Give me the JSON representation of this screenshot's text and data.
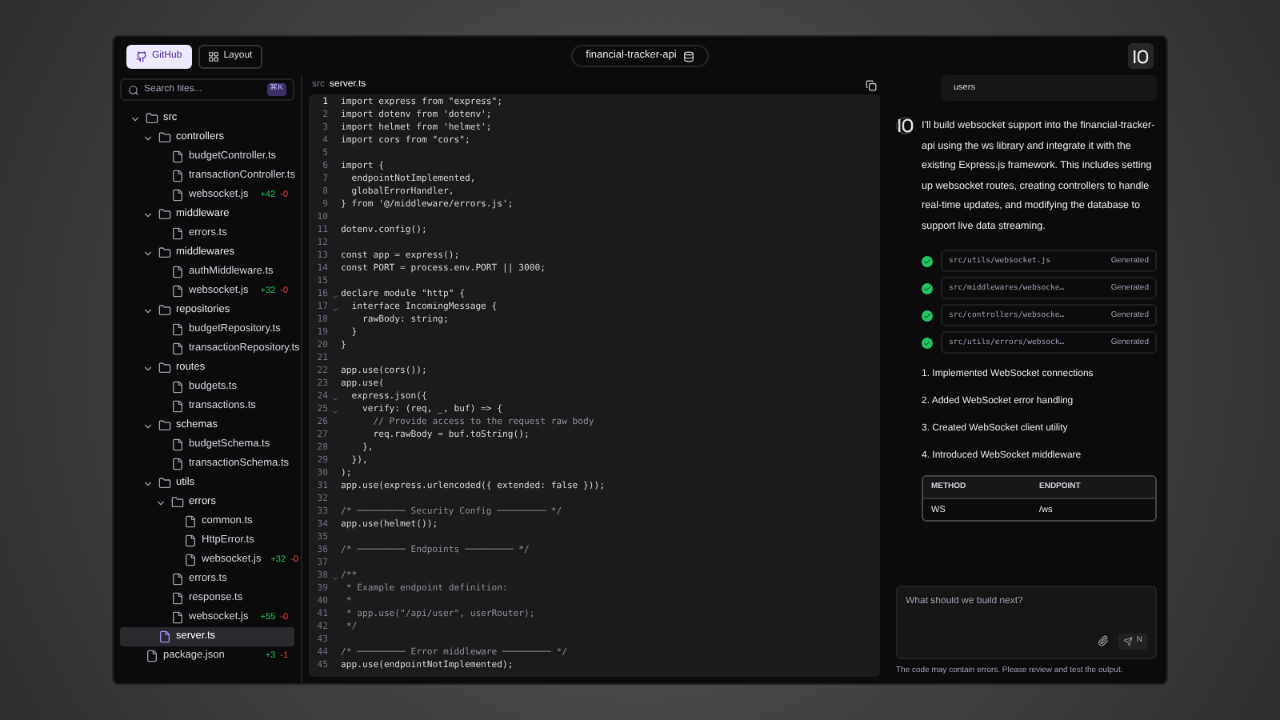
{
  "header": {
    "tabs": [
      {
        "label": "GitHub",
        "selected": true
      },
      {
        "label": "Layout",
        "selected": false
      }
    ],
    "project": "financial-tracker-api"
  },
  "sidebar": {
    "search": {
      "placeholder": "Search files...",
      "shortcut": "⌘K"
    },
    "tree": [
      {
        "name": "src",
        "kind": "folder",
        "expanded": true,
        "children": [
          {
            "name": "controllers",
            "kind": "folder",
            "expanded": true,
            "children": [
              {
                "name": "budgetController.ts",
                "kind": "file",
                "selected": false
              },
              {
                "name": "transactionController.ts",
                "kind": "file",
                "selected": false
              },
              {
                "name": "websocket.js",
                "kind": "file",
                "selected": false,
                "added": "+42",
                "removed": "-0"
              }
            ]
          },
          {
            "name": "middleware",
            "kind": "folder",
            "expanded": true,
            "children": [
              {
                "name": "errors.ts",
                "kind": "file",
                "selected": false
              }
            ]
          },
          {
            "name": "middlewares",
            "kind": "folder",
            "expanded": true,
            "children": [
              {
                "name": "authMiddleware.ts",
                "kind": "file",
                "selected": false
              },
              {
                "name": "websocket.js",
                "kind": "file",
                "selected": false,
                "added": "+32",
                "removed": "-0"
              }
            ]
          },
          {
            "name": "repositories",
            "kind": "folder",
            "expanded": true,
            "children": [
              {
                "name": "budgetRepository.ts",
                "kind": "file",
                "selected": false
              },
              {
                "name": "transactionRepository.ts",
                "kind": "file",
                "selected": false
              }
            ]
          },
          {
            "name": "routes",
            "kind": "folder",
            "expanded": true,
            "children": [
              {
                "name": "budgets.ts",
                "kind": "file",
                "selected": false
              },
              {
                "name": "transactions.ts",
                "kind": "file",
                "selected": false
              }
            ]
          },
          {
            "name": "schemas",
            "kind": "folder",
            "expanded": true,
            "children": [
              {
                "name": "budgetSchema.ts",
                "kind": "file",
                "selected": false
              },
              {
                "name": "transactionSchema.ts",
                "kind": "file",
                "selected": false
              }
            ]
          },
          {
            "name": "utils",
            "kind": "folder",
            "expanded": true,
            "children": [
              {
                "name": "errors",
                "kind": "folder",
                "expanded": true,
                "children": [
                  {
                    "name": "common.ts",
                    "kind": "file",
                    "selected": false
                  },
                  {
                    "name": "HttpError.ts",
                    "kind": "file",
                    "selected": false
                  },
                  {
                    "name": "websocket.js",
                    "kind": "file",
                    "selected": false,
                    "added": "+32",
                    "removed": "-0"
                  }
                ]
              },
              {
                "name": "errors.ts",
                "kind": "file",
                "selected": false
              },
              {
                "name": "response.ts",
                "kind": "file",
                "selected": false
              },
              {
                "name": "websocket.js",
                "kind": "file",
                "selected": false,
                "added": "+55",
                "removed": "-0"
              }
            ]
          },
          {
            "name": "server.ts",
            "kind": "file",
            "selected": true
          }
        ]
      },
      {
        "name": "package.json",
        "kind": "file",
        "selected": false,
        "added": "+3",
        "removed": "-1"
      }
    ]
  },
  "editor": {
    "path": [
      "src",
      "server.ts"
    ],
    "lines": [
      {
        "number": "1",
        "kind": "code",
        "code": "import express from \"express\";"
      },
      {
        "number": "2",
        "kind": "code",
        "code": "import dotenv from 'dotenv';"
      },
      {
        "number": "3",
        "kind": "code",
        "code": "import helmet from 'helmet';"
      },
      {
        "number": "4",
        "kind": "code",
        "code": "import cors from \"cors\";"
      },
      {
        "number": "5"
      },
      {
        "number": "6",
        "kind": "code",
        "code": "import {"
      },
      {
        "number": "7",
        "kind": "code",
        "code": "  endpointNotImplemented,"
      },
      {
        "number": "8",
        "kind": "code",
        "code": "  globalErrorHandler,"
      },
      {
        "number": "9",
        "kind": "code",
        "code": "} from '@/middleware/errors.js';"
      },
      {
        "number": "10"
      },
      {
        "number": "11",
        "kind": "code",
        "code": "dotenv.config();"
      },
      {
        "number": "12"
      },
      {
        "number": "13",
        "kind": "code",
        "code": "const app = express();"
      },
      {
        "number": "14",
        "kind": "code",
        "code": "const PORT = process.env.PORT || 3000;"
      },
      {
        "number": "15"
      },
      {
        "number": "16",
        "kind": "code",
        "foldable": true,
        "code": "declare module \"http\" {"
      },
      {
        "number": "17",
        "kind": "code",
        "foldable": true,
        "code": "  interface IncomingMessage {"
      },
      {
        "number": "18",
        "kind": "code",
        "code": "    rawBody: string;"
      },
      {
        "number": "19",
        "kind": "code",
        "code": "  }"
      },
      {
        "number": "20",
        "kind": "code",
        "code": "}"
      },
      {
        "number": "21"
      },
      {
        "number": "22",
        "kind": "code",
        "code": "app.use(cors());"
      },
      {
        "number": "23",
        "kind": "code",
        "code": "app.use("
      },
      {
        "number": "24",
        "kind": "code",
        "foldable": true,
        "code": "  express.json({"
      },
      {
        "number": "25",
        "kind": "code",
        "foldable": true,
        "code": "    verify: (req, _, buf) => {"
      },
      {
        "number": "26",
        "kind": "comment",
        "code": "      // Provide access to the request raw body"
      },
      {
        "number": "27",
        "kind": "code",
        "code": "      req.rawBody = buf.toString();"
      },
      {
        "number": "28",
        "kind": "code",
        "code": "    },"
      },
      {
        "number": "29",
        "kind": "code",
        "code": "  }),"
      },
      {
        "number": "30",
        "kind": "code",
        "code": ");"
      },
      {
        "number": "31",
        "kind": "code",
        "code": "app.use(express.urlencoded({ extended: false }));"
      },
      {
        "number": "32"
      },
      {
        "number": "33",
        "kind": "comment",
        "code": "/* ───────── Security Config ───────── */"
      },
      {
        "number": "34",
        "kind": "code",
        "code": "app.use(helmet());"
      },
      {
        "number": "35"
      },
      {
        "number": "36",
        "kind": "comment",
        "code": "/* ───────── Endpoints ───────── */"
      },
      {
        "number": "37"
      },
      {
        "number": "38",
        "kind": "comment",
        "foldable": true,
        "code": "/**"
      },
      {
        "number": "39",
        "kind": "comment",
        "code": " * Example endpoint definition:"
      },
      {
        "number": "40",
        "kind": "comment",
        "code": " *"
      },
      {
        "number": "41",
        "kind": "comment",
        "code": " * app.use(\"/api/user\", userRouter);"
      },
      {
        "number": "42",
        "kind": "comment",
        "code": " */"
      },
      {
        "number": "43"
      },
      {
        "number": "44",
        "kind": "comment",
        "code": "/* ───────── Error middleware ───────── */"
      },
      {
        "number": "45",
        "kind": "code",
        "code": "app.use(endpointNotImplemented);"
      }
    ]
  },
  "chat": {
    "user_message": "users",
    "reply": "I'll build websocket support into the financial-tracker-api using the ws library and integrate it with the existing Express.js framework. This includes setting up websocket routes, creating controllers to handle real-time updates, and modifying the database to support live data streaming.",
    "files": [
      {
        "path": "src/utils/websocket.js",
        "status": "Generated",
        "done": true
      },
      {
        "path": "src/middlewares/websocke…",
        "status": "Generated",
        "done": true
      },
      {
        "path": "src/controllers/websocke…",
        "status": "Generated",
        "done": true
      },
      {
        "path": "src/utils/errors/websock…",
        "status": "Generated",
        "done": true
      }
    ],
    "steps": [
      "1. Implemented WebSocket connections",
      "2. Added WebSocket error handling",
      "3. Created WebSocket client utility",
      "4. Introduced WebSocket middleware"
    ],
    "table": {
      "columns": [
        "METHOD",
        "ENDPOINT"
      ],
      "rows": [
        [
          "WS",
          "/ws"
        ]
      ]
    },
    "input": {
      "placeholder": "What should we build next?",
      "model": "N"
    },
    "disclaimer": "The code may contain errors. Please review and test the output."
  }
}
